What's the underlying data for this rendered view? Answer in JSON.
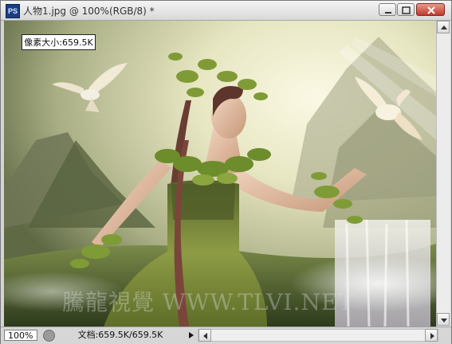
{
  "window": {
    "app_icon": "PS",
    "title": "人物1.jpg @ 100%(RGB/8) *",
    "controls": [
      "minimize-icon",
      "maximize-icon",
      "close-icon"
    ]
  },
  "canvas": {
    "size_info": "像素大小:659.5K",
    "watermark": "騰龍視覺 WWW.TLVI.NET"
  },
  "status": {
    "zoom": "100%",
    "doc_size": "文档:659.5K/659.5K"
  },
  "colors": {
    "title_bar": "#e6e6e6",
    "close_button": "#c1392b",
    "photo_highlight": "#f3f2d8",
    "photo_foliage": "#5f7d2f"
  }
}
